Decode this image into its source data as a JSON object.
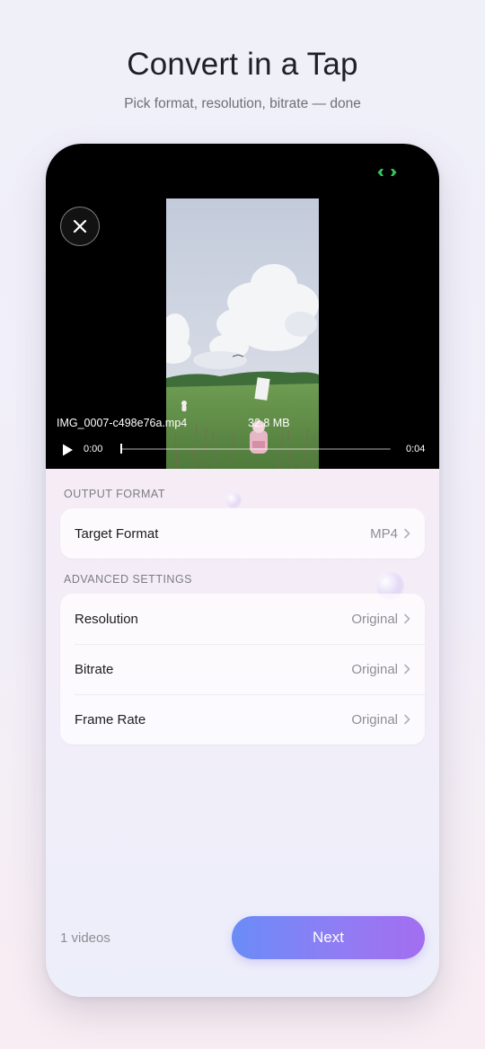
{
  "hero": {
    "title": "Convert in a Tap",
    "subtitle": "Pick format, resolution, bitrate — done"
  },
  "player": {
    "file_name": "IMG_0007-c498e76a.mp4",
    "file_size": "32.8 MB",
    "current_time": "0:00",
    "duration": "0:04",
    "progress": 0,
    "icons": {
      "close": "close-icon",
      "play": "play-icon",
      "expand": "expand-icon"
    },
    "expand_icon_color": "#34c759"
  },
  "output_format": {
    "section_label": "OUTPUT FORMAT",
    "rows": [
      {
        "label": "Target Format",
        "value": "MP4"
      }
    ]
  },
  "advanced_settings": {
    "section_label": "ADVANCED SETTINGS",
    "rows": [
      {
        "label": "Resolution",
        "value": "Original"
      },
      {
        "label": "Bitrate",
        "value": "Original"
      },
      {
        "label": "Frame Rate",
        "value": "Original"
      }
    ]
  },
  "footer": {
    "videos_count": "1 videos",
    "next_label": "Next"
  },
  "colors": {
    "accent_start": "#6a8cf7",
    "accent_end": "#a36ef0"
  }
}
